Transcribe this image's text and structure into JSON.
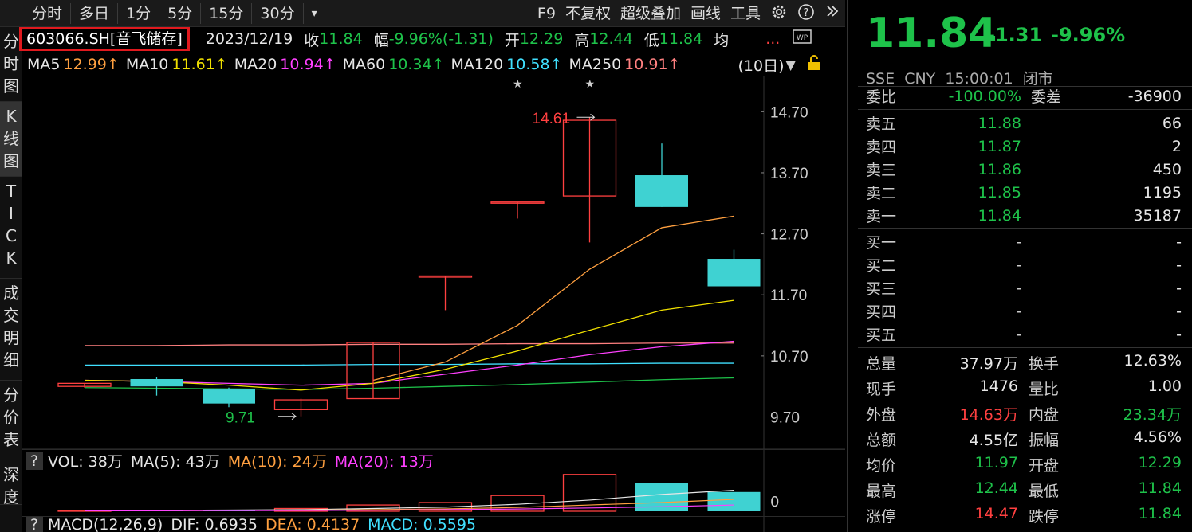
{
  "toolbar": {
    "left": [
      "分时",
      "多日",
      "1分",
      "5分",
      "15分",
      "30分",
      "▾"
    ],
    "right": [
      "F9",
      "不复权",
      "超级叠加",
      "画线",
      "工具"
    ]
  },
  "side_tabs": [
    "分\n时\n图",
    "K\n线\n图",
    "T\nI\nC\nK",
    "成\n交\n明\n细",
    "分\n价\n表",
    "深\n度"
  ],
  "info": {
    "code": "603066.SH[音飞储存]",
    "date": "2023/12/19",
    "close_label": "收",
    "close": "11.84",
    "range_label": "幅",
    "range": "-9.96%(-1.31)",
    "open_label": "开",
    "open": "12.29",
    "high_label": "高",
    "high": "12.44",
    "low_label": "低",
    "low": "11.84",
    "avg_label": "均",
    "dots": "..."
  },
  "ma": {
    "ma5_label": "MA5",
    "ma5": "12.99↑",
    "ma10_label": "MA10",
    "ma10": "11.61↑",
    "ma20_label": "MA20",
    "ma20": "10.94↑",
    "ma60_label": "MA60",
    "ma60": "10.34↑",
    "ma120_label": "MA120",
    "ma120": "10.58↑",
    "ma250_label": "MA250",
    "ma250": "10.91↑",
    "period": "(10日)"
  },
  "colors": {
    "up": "#ff4040",
    "down": "#1ec24a",
    "down_fill": "#3fd2d2",
    "ma5": "#ffa040",
    "ma10": "#f0e000",
    "ma20": "#ff40ff",
    "ma60": "#1ec24a",
    "ma120": "#40e0ff",
    "ma250": "#ff8080"
  },
  "chart_data": {
    "type": "candlestick",
    "y_ticks": [
      "14.70",
      "13.70",
      "12.70",
      "11.70",
      "10.70",
      "9.70"
    ],
    "ylim": [
      9.25,
      15.2
    ],
    "candles": [
      {
        "o": 10.2,
        "c": 10.25,
        "h": 10.25,
        "l": 10.18
      },
      {
        "o": 10.32,
        "c": 10.2,
        "h": 10.35,
        "l": 10.05
      },
      {
        "o": 10.15,
        "c": 9.92,
        "h": 10.18,
        "l": 9.86
      },
      {
        "o": 9.82,
        "c": 9.98,
        "h": 10.0,
        "l": 9.71
      },
      {
        "o": 10.0,
        "c": 10.92,
        "h": 10.92,
        "l": 10.0
      },
      {
        "o": 12.01,
        "c": 12.01,
        "h": 12.01,
        "l": 11.45
      },
      {
        "o": 13.22,
        "c": 13.22,
        "h": 13.22,
        "l": 12.95
      },
      {
        "o": 13.32,
        "c": 14.56,
        "h": 14.61,
        "l": 12.56
      },
      {
        "o": 13.66,
        "c": 13.14,
        "h": 14.18,
        "l": 13.14
      },
      {
        "o": 12.29,
        "c": 11.84,
        "h": 12.44,
        "l": 11.84
      }
    ],
    "annotations": {
      "high": "14.61",
      "low": "9.71"
    },
    "ma5": [
      null,
      null,
      null,
      null,
      10.3,
      10.6,
      11.2,
      12.12,
      12.8,
      12.99
    ],
    "ma10": [
      10.3,
      10.28,
      10.22,
      10.14,
      10.25,
      10.48,
      10.78,
      11.12,
      11.45,
      11.61
    ],
    "ma20": [
      10.3,
      10.28,
      10.25,
      10.22,
      10.25,
      10.4,
      10.55,
      10.72,
      10.85,
      10.94
    ],
    "ma60": [
      10.18,
      10.17,
      10.16,
      10.15,
      10.17,
      10.2,
      10.23,
      10.27,
      10.31,
      10.34
    ],
    "ma120": [
      10.55,
      10.55,
      10.55,
      10.55,
      10.56,
      10.56,
      10.57,
      10.57,
      10.58,
      10.58
    ],
    "ma250": [
      10.87,
      10.87,
      10.88,
      10.88,
      10.89,
      10.89,
      10.9,
      10.9,
      10.91,
      10.91
    ]
  },
  "vol": {
    "help": "?",
    "title": "VOL: 38万",
    "ma5": "MA(5): 43万",
    "ma10": "MA(10): 24万",
    "ma20": "MA(20): 13万",
    "zero": "0"
  },
  "macd": {
    "help": "?",
    "title": "MACD(12,26,9)",
    "dif": "DIF: 0.6935",
    "dea": "DEA: 0.4137",
    "macd": "MACD: 0.5595"
  },
  "quote": {
    "price": "11.84",
    "change": "-1.31",
    "pct": "-9.96%",
    "exchange": "SSE  CNY  15:00:01  闭市",
    "weibi_label": "委比",
    "weibi": "-100.00%",
    "weicha_label": "委差",
    "weicha": "-36900",
    "asks": [
      {
        "label": "卖五",
        "price": "11.88",
        "vol": "66"
      },
      {
        "label": "卖四",
        "price": "11.87",
        "vol": "2"
      },
      {
        "label": "卖三",
        "price": "11.86",
        "vol": "450"
      },
      {
        "label": "卖二",
        "price": "11.85",
        "vol": "1195"
      },
      {
        "label": "卖一",
        "price": "11.84",
        "vol": "35187"
      }
    ],
    "bids": [
      {
        "label": "买一",
        "price": "-",
        "vol": "-"
      },
      {
        "label": "买二",
        "price": "-",
        "vol": "-"
      },
      {
        "label": "买三",
        "price": "-",
        "vol": "-"
      },
      {
        "label": "买四",
        "price": "-",
        "vol": "-"
      },
      {
        "label": "买五",
        "price": "-",
        "vol": "-"
      }
    ],
    "stats": [
      {
        "l1": "总量",
        "v1": "37.97万",
        "l2": "换手",
        "v2": "12.63%"
      },
      {
        "l1": "现手",
        "v1": "1476",
        "l2": "量比",
        "v2": "1.00"
      },
      {
        "l1": "外盘",
        "v1": "14.63万",
        "l2": "内盘",
        "v2": "23.34万"
      },
      {
        "l1": "总额",
        "v1": "4.55亿",
        "l2": "振幅",
        "v2": "4.56%"
      },
      {
        "l1": "均价",
        "v1": "11.97",
        "l2": "开盘",
        "v2": "12.29"
      },
      {
        "l1": "最高",
        "v1": "12.44",
        "l2": "最低",
        "v2": "11.84"
      },
      {
        "l1": "涨停",
        "v1": "14.47",
        "l2": "跌停",
        "v2": "11.84"
      }
    ]
  }
}
